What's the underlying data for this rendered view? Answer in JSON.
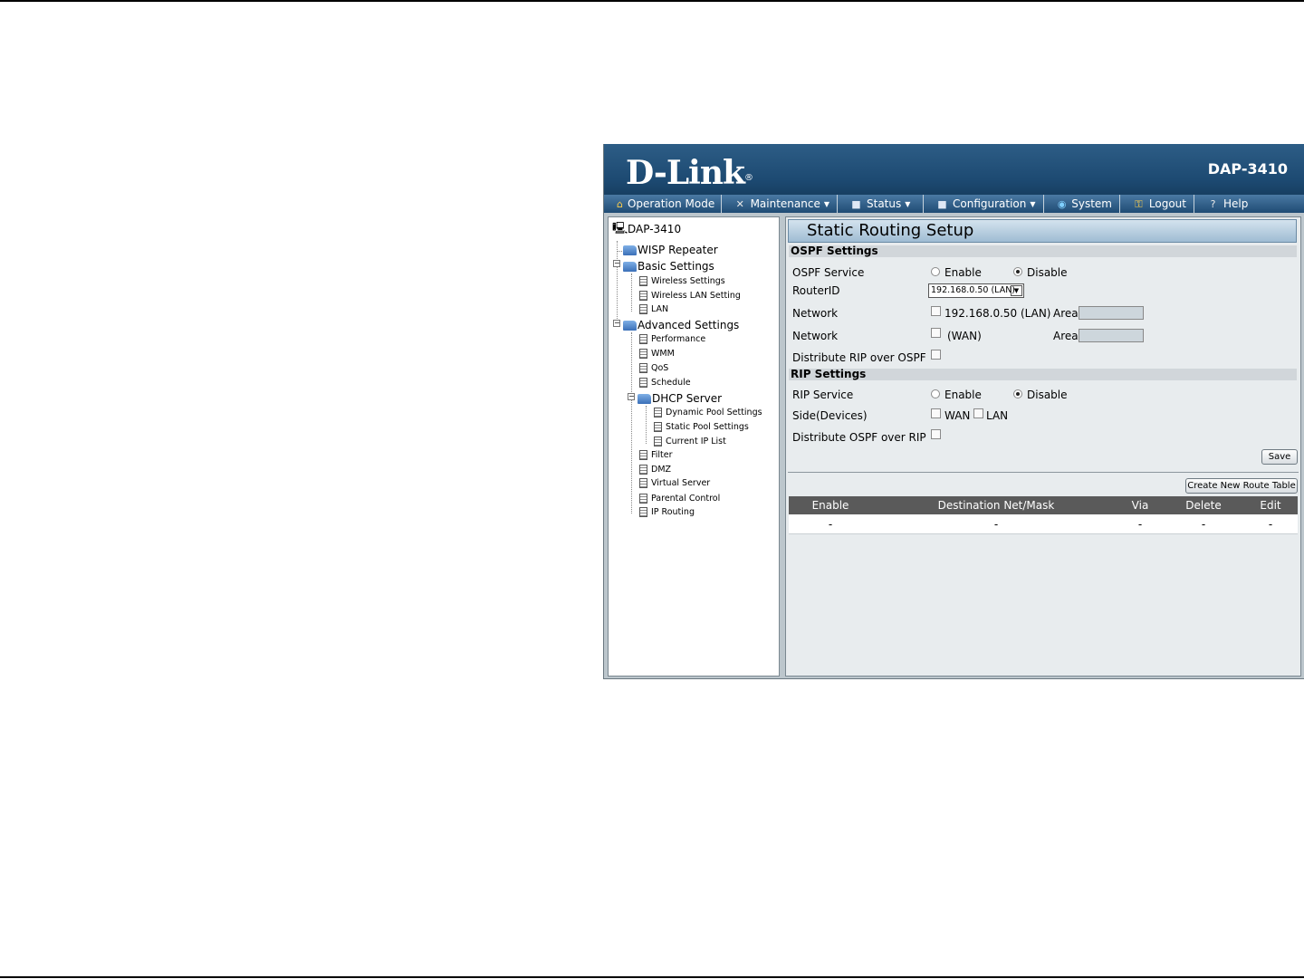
{
  "app": {
    "logo": "D-Link",
    "logo_mark": "®",
    "model": "DAP-3410"
  },
  "menu": [
    {
      "label": "Operation Mode",
      "icon": "home-icon",
      "caret": false
    },
    {
      "label": "Maintenance",
      "icon": "tools-icon",
      "caret": true
    },
    {
      "label": "Status",
      "icon": "disk-icon",
      "caret": true
    },
    {
      "label": "Configuration",
      "icon": "disk-icon",
      "caret": true
    },
    {
      "label": "System",
      "icon": "globe-icon",
      "caret": false
    },
    {
      "label": "Logout",
      "icon": "key-icon",
      "caret": false
    },
    {
      "label": "Help",
      "icon": "help-icon",
      "caret": false
    }
  ],
  "tree": {
    "root": "DAP-3410",
    "wisp": "WISP Repeater",
    "basic": "Basic Settings",
    "basic_items": [
      "Wireless Settings",
      "Wireless LAN Setting",
      "LAN"
    ],
    "advanced": "Advanced Settings",
    "adv_items_a": [
      "Performance",
      "WMM",
      "QoS",
      "Schedule"
    ],
    "dhcp": "DHCP Server",
    "dhcp_items": [
      "Dynamic Pool Settings",
      "Static Pool Settings",
      "Current IP List"
    ],
    "adv_items_b": [
      "Filter",
      "DMZ",
      "Virtual Server",
      "Parental Control",
      "IP Routing"
    ],
    "expander": "−"
  },
  "page": {
    "title": "Static Routing Setup",
    "ospf": {
      "section": "OSPF Settings",
      "service_label": "OSPF Service",
      "enable": "Enable",
      "disable": "Disable",
      "service_value": "Disable",
      "routerid_label": "RouterID",
      "routerid_value": "192.168.0.50 (LAN)",
      "network_label": "Network",
      "network_lan": "192.168.0.50 (LAN)",
      "network_wan": "(WAN)",
      "area_label": "Area",
      "distribute_label": "Distribute RIP over OSPF"
    },
    "rip": {
      "section": "RIP Settings",
      "service_label": "RIP Service",
      "enable": "Enable",
      "disable": "Disable",
      "service_value": "Disable",
      "side_label": "Side(Devices)",
      "wan": "WAN",
      "lan": "LAN",
      "distribute_label": "Distribute OSPF over RIP"
    },
    "save_label": "Save",
    "create_label": "Create New Route Table",
    "table": {
      "headers": [
        "Enable",
        "Destination Net/Mask",
        "Via",
        "Delete",
        "Edit"
      ],
      "rows": [
        [
          "-",
          "-",
          "-",
          "-",
          "-"
        ]
      ]
    }
  }
}
